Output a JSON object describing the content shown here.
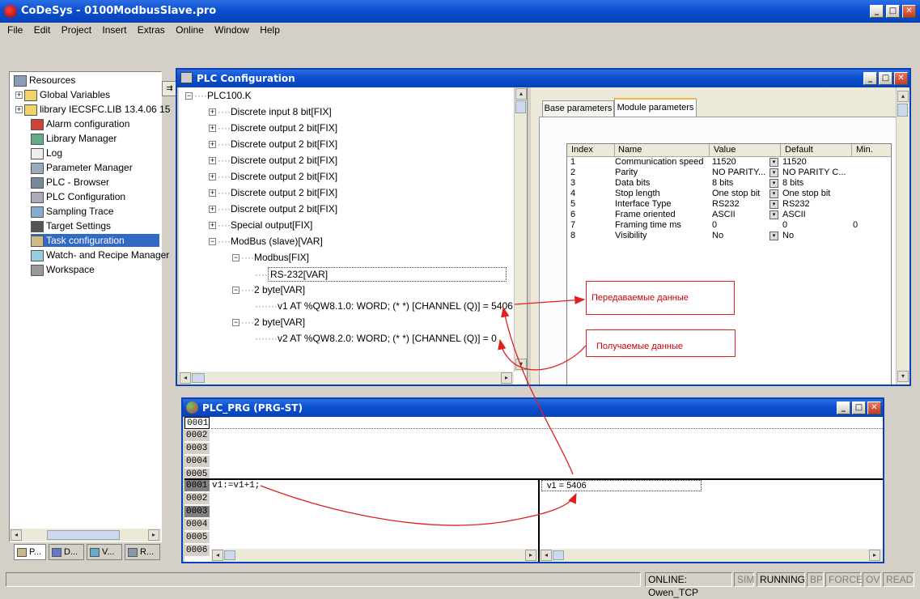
{
  "app": {
    "title": "CoDeSys - 0100ModbusSlave.pro"
  },
  "menu": [
    "File",
    "Edit",
    "Project",
    "Insert",
    "Extras",
    "Online",
    "Window",
    "Help"
  ],
  "resources": {
    "items": [
      "Resources",
      "Global Variables",
      "library IECSFC.LIB 13.4.06 15",
      "Alarm configuration",
      "Library Manager",
      "Log",
      "Parameter Manager",
      "PLC - Browser",
      "PLC Configuration",
      "Sampling Trace",
      "Target Settings",
      "Task configuration",
      "Watch- and Recipe Manager",
      "Workspace"
    ],
    "selected": "Task configuration",
    "tabs": [
      "P...",
      "D...",
      "V...",
      "R..."
    ]
  },
  "plc_config": {
    "title": "PLC Configuration",
    "tree": [
      "PLC100.K",
      "Discrete input 8 bit[FIX]",
      "Discrete output 2 bit[FIX]",
      "Discrete output 2 bit[FIX]",
      "Discrete output 2 bit[FIX]",
      "Discrete output 2 bit[FIX]",
      "Discrete output 2 bit[FIX]",
      "Discrete output 2 bit[FIX]",
      "Special output[FIX]",
      "ModBus (slave)[VAR]",
      "Modbus[FIX]",
      "RS-232[VAR]",
      "2 byte[VAR]",
      "v1 AT %QW8.1.0: WORD; (*  *) [CHANNEL (Q)] = 5406",
      "2 byte[VAR]",
      "v2 AT %QW8.2.0: WORD; (*  *) [CHANNEL (Q)] = 0"
    ],
    "tabs": [
      "Base parameters",
      "Module parameters"
    ],
    "table": {
      "headers": [
        "Index",
        "Name",
        "Value",
        "Default",
        "Min."
      ],
      "rows": [
        [
          "1",
          "Communication speed",
          "11520",
          "11520",
          ""
        ],
        [
          "2",
          "Parity",
          "NO PARITY...",
          "NO PARITY C...",
          ""
        ],
        [
          "3",
          "Data bits",
          "8 bits",
          "8 bits",
          ""
        ],
        [
          "4",
          "Stop length",
          "One stop bit",
          "One stop bit",
          ""
        ],
        [
          "5",
          "Interface Type",
          "RS232",
          "RS232",
          ""
        ],
        [
          "6",
          "Frame oriented",
          "ASCII",
          "ASCII",
          ""
        ],
        [
          "7",
          "Framing time ms",
          "0",
          "0",
          "0"
        ],
        [
          "8",
          "Visibility",
          "No",
          "No",
          ""
        ]
      ]
    }
  },
  "annotations": {
    "sent": "Передаваемые данные",
    "received": "Получаемые данные"
  },
  "prg": {
    "title": "PLC_PRG (PRG-ST)",
    "decl_lines": [
      "0001",
      "0002",
      "0003",
      "0004",
      "0005"
    ],
    "code_lines": [
      "0001",
      "0002",
      "0003",
      "0004",
      "0005",
      "0006"
    ],
    "code": "v1:=v1+1;",
    "watch": "v1 = 5406"
  },
  "status": [
    "ONLINE: Owen_TCP",
    "SIM",
    "RUNNING",
    "BP",
    "FORCE",
    "OV",
    "READ"
  ],
  "colors": {
    "title_blue": "#0a4fd0",
    "selection": "#316ac5",
    "annot_red": "#e02020"
  }
}
